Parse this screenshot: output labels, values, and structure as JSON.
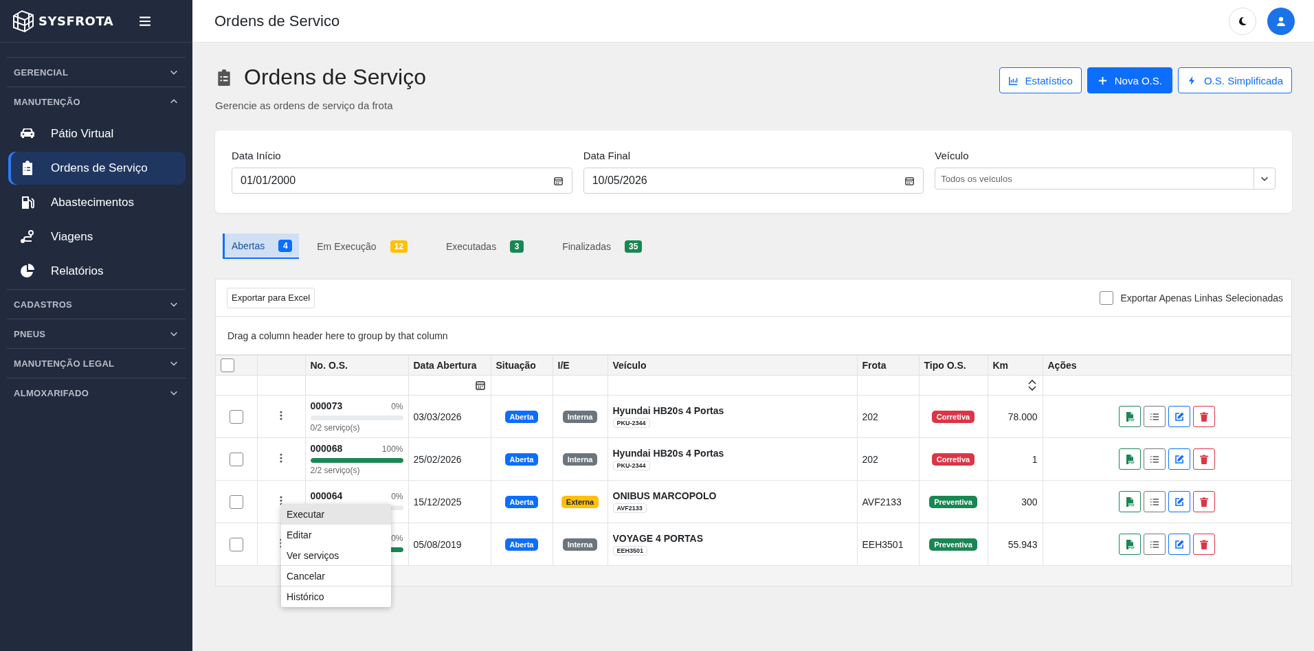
{
  "sidebar": {
    "brand": "SYSFROTA",
    "sections": [
      {
        "label": "GERENCIAL",
        "expanded": false
      },
      {
        "label": "MANUTENÇÃO",
        "expanded": true,
        "items": [
          {
            "label": "Pátio Virtual",
            "selected": false
          },
          {
            "label": "Ordens de Serviço",
            "selected": true
          },
          {
            "label": "Abastecimentos",
            "selected": false
          },
          {
            "label": "Viagens",
            "selected": false
          },
          {
            "label": "Relatórios",
            "selected": false
          }
        ]
      },
      {
        "label": "CADASTROS",
        "expanded": false
      },
      {
        "label": "PNEUS",
        "expanded": false
      },
      {
        "label": "MANUTENÇÃO LEGAL",
        "expanded": false
      },
      {
        "label": "ALMOXARIFADO",
        "expanded": false
      }
    ]
  },
  "topbar": {
    "title": "Ordens de Servico"
  },
  "page": {
    "title": "Ordens de Serviço",
    "subtitle": "Gerencie as ordens de serviço da frota",
    "actions": [
      {
        "label": "Estatístico",
        "kind": "outline"
      },
      {
        "label": "Nova O.S.",
        "kind": "solid"
      },
      {
        "label": "O.S. Simplificada",
        "kind": "outline"
      }
    ]
  },
  "filters": [
    {
      "label": "Data Início",
      "kind": "date",
      "value": "01/01/2000"
    },
    {
      "label": "Data Final",
      "kind": "date",
      "value": "10/05/2026"
    },
    {
      "label": "Veículo",
      "kind": "select",
      "placeholder": "Todos os veículos"
    }
  ],
  "tabs": [
    {
      "label": "Abertas",
      "count": "4",
      "color": "#0d6efd",
      "selected": true
    },
    {
      "label": "Em Execução",
      "count": "12",
      "color": "#ffc107",
      "selected": false
    },
    {
      "label": "Executadas",
      "count": "3",
      "color": "#198754",
      "selected": false
    },
    {
      "label": "Finalizadas",
      "count": "35",
      "color": "#198754",
      "selected": false
    }
  ],
  "grid": {
    "export_button": "Exportar para Excel",
    "export_selected": {
      "label": "Exportar Apenas Linhas Selecionadas",
      "checked": false
    },
    "group_hint": "Drag a column header here to group by that column",
    "select_all_checked": false,
    "columns": [
      "No. O.S.",
      "Data Abertura",
      "Situação",
      "I/E",
      "Veículo",
      "Frota",
      "Tipo O.S.",
      "Km",
      "Ações"
    ],
    "rows": [
      {
        "checked": false,
        "number": "000073",
        "progress": "0%",
        "level": 0,
        "services": "0/2 serviço(s)",
        "opened": "03/03/2026",
        "status": {
          "label": "Aberta",
          "color": "#0d6efd"
        },
        "origin": {
          "label": "Interna",
          "color": "#6c757d"
        },
        "vehicle": "Hyundai HB20s 4 Portas",
        "plate": "PKU-2344",
        "fleet": "202",
        "type": {
          "label": "Corretiva",
          "color": "#dc3545"
        },
        "km": "78.000"
      },
      {
        "checked": false,
        "number": "000068",
        "progress": "100%",
        "level": 1,
        "services": "2/2 serviço(s)",
        "opened": "25/02/2026",
        "status": {
          "label": "Aberta",
          "color": "#0d6efd"
        },
        "origin": {
          "label": "Interna",
          "color": "#6c757d"
        },
        "vehicle": "Hyundai HB20s 4 Portas",
        "plate": "PKU-2344",
        "fleet": "202",
        "type": {
          "label": "Corretiva",
          "color": "#dc3545"
        },
        "km": "1"
      },
      {
        "checked": false,
        "number": "000064",
        "progress": "0%",
        "level": 0,
        "opened": "15/12/2025",
        "status": {
          "label": "Aberta",
          "color": "#0d6efd"
        },
        "origin": {
          "label": "Externa",
          "color": "#ffc107"
        },
        "vehicle": "ONIBUS MARCOPOLO",
        "plate": "AVF2133",
        "fleet": "AVF2133",
        "type": {
          "label": "Preventiva",
          "color": "#198754"
        },
        "km": "300"
      },
      {
        "checked": false,
        "progress": "0%",
        "level": 1,
        "opened": "05/08/2019",
        "status": {
          "label": "Aberta",
          "color": "#0d6efd"
        },
        "origin": {
          "label": "Interna",
          "color": "#6c757d"
        },
        "vehicle": "VOYAGE 4 PORTAS",
        "plate": "EEH3501",
        "fleet": "EEH3501",
        "type": {
          "label": "Preventiva",
          "color": "#198754"
        },
        "km": "55.943"
      }
    ]
  },
  "context_menu": {
    "items": [
      {
        "label": "Executar",
        "selected": true
      },
      {
        "label": "Editar",
        "selected": false
      },
      {
        "label": "Ver serviços",
        "selected": false,
        "divider_after": true
      },
      {
        "label": "Cancelar",
        "selected": false,
        "divider_after": true
      },
      {
        "label": "Histórico",
        "selected": false
      }
    ]
  }
}
